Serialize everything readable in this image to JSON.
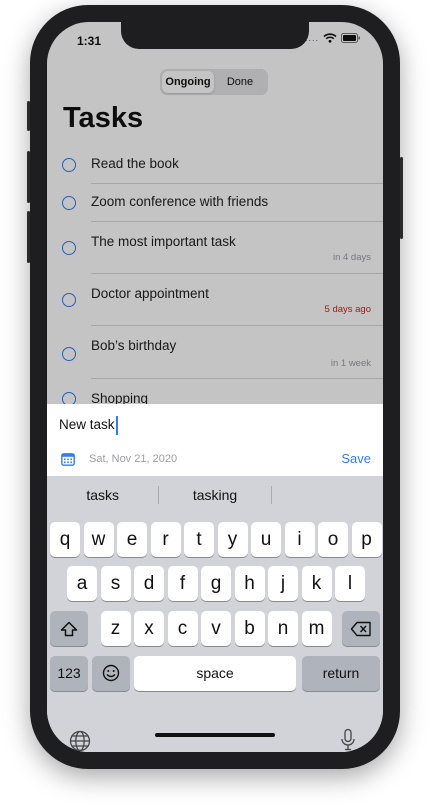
{
  "status": {
    "time": "1:31",
    "signal_dots": "....",
    "wifi_icon": "wifi-icon",
    "battery_icon": "battery-icon"
  },
  "segment": {
    "options": [
      "Ongoing",
      "Done"
    ],
    "selected": "Ongoing"
  },
  "page_title": "Tasks",
  "tasks": [
    {
      "title": "Read the book",
      "due": ""
    },
    {
      "title": "Zoom conference with friends",
      "due": ""
    },
    {
      "title": "The most important task",
      "due": "in 4 days",
      "overdue": false
    },
    {
      "title": "Doctor appointment",
      "due": "5 days ago",
      "overdue": true
    },
    {
      "title": "Bob’s birthday",
      "due": "in 1 week",
      "overdue": false
    },
    {
      "title": "Shopping",
      "due": ""
    }
  ],
  "composer": {
    "input_value": "New task",
    "date_placeholder": "Sat, Nov 21, 2020",
    "save_label": "Save",
    "calendar_icon": "calendar-icon"
  },
  "keyboard": {
    "suggestions": [
      "tasks",
      "tasking",
      ""
    ],
    "row1": [
      "q",
      "w",
      "e",
      "r",
      "t",
      "y",
      "u",
      "i",
      "o",
      "p"
    ],
    "row2": [
      "a",
      "s",
      "d",
      "f",
      "g",
      "h",
      "j",
      "k",
      "l"
    ],
    "row3": [
      "z",
      "x",
      "c",
      "v",
      "b",
      "n",
      "m"
    ],
    "numbers_label": "123",
    "space_label": "space",
    "return_label": "return",
    "shift_icon": "shift-icon",
    "delete_icon": "delete-icon",
    "emoji_icon": "emoji-icon",
    "globe_icon": "globe-icon",
    "mic_icon": "microphone-icon"
  },
  "colors": {
    "accent": "#2f7cf6",
    "overdue": "#d0251f",
    "due_muted": "#9d9da2",
    "keyboard_bg": "#d1d3d9"
  }
}
